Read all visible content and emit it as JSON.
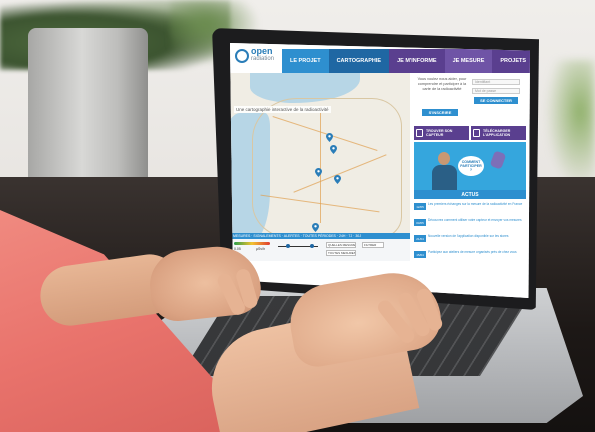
{
  "site": {
    "logo": {
      "name": "open",
      "sub": "radiation"
    },
    "nav": [
      {
        "label": "LE PROJET",
        "tone": "blue"
      },
      {
        "label": "CARTOGRAPHIE",
        "tone": "dark"
      },
      {
        "label": "JE M'INFORME",
        "tone": "purple"
      },
      {
        "label": "JE MESURE",
        "tone": "violet"
      },
      {
        "label": "PROJETS",
        "tone": "purple"
      }
    ],
    "map": {
      "caption": "Une cartographie interactive de la radioactivité",
      "marker_color": "#2a7db8",
      "bar_text": "MESURES · SIGNALEMENTS · ALERTES · TOUTES PÉRIODES · 24H · 7J · 30J",
      "legend": {
        "scale_low": "0.05",
        "scale_high": "µSv/h",
        "filter_1": "QUELLES MESURES",
        "filter_2": "TOUTES MESURES",
        "filter_3": "FILTRER"
      }
    },
    "sidebar": {
      "intro": "Vous voulez nous aider, pour comprendre et participer à la carte de la radioactivité",
      "signup_label": "S'INSCRIRE",
      "login_label": "SE CONNECTER",
      "user_placeholder": "Identifiant",
      "pass_placeholder": "Mot de passe",
      "promo_1": "TROUVER SON CAPTEUR",
      "promo_2": "TÉLÉCHARGER L'APPLICATION",
      "hero_bubble": "COMMENT PARTICIPER ?",
      "actus_title": "ACTUS",
      "news": [
        {
          "date": "12/05",
          "text": "Les premiers échanges sur la mesure de la radioactivité en France"
        },
        {
          "date": "03/05",
          "text": "Découvrez comment utiliser votre capteur et envoyer vos mesures"
        },
        {
          "date": "21/04",
          "text": "Nouvelle version de l'application disponible sur les stores"
        },
        {
          "date": "15/04",
          "text": "Participez aux ateliers de mesure organisés près de chez vous"
        }
      ]
    }
  },
  "colors": {
    "brand_blue": "#2e8fcf",
    "brand_dark": "#1f67a3",
    "brand_purple": "#5a3f8f",
    "sleeve": "#e9736c"
  }
}
